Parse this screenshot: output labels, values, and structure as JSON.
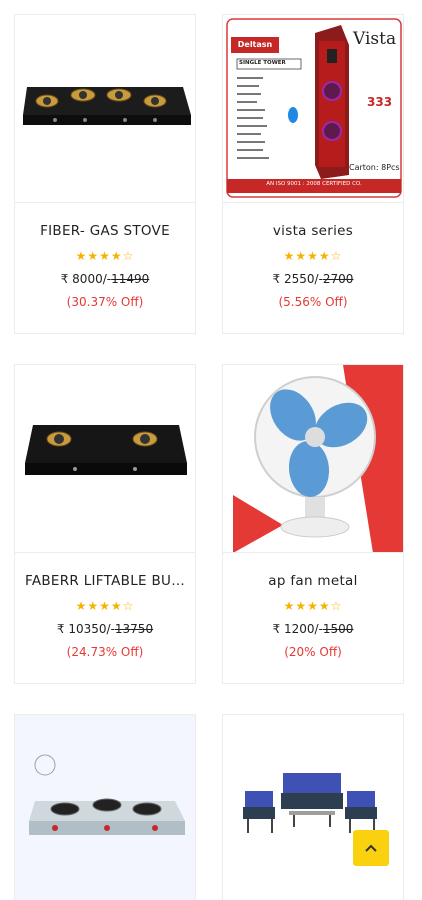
{
  "products": [
    {
      "name": "FIBER- GAS STOVE",
      "stars": "★★★★☆",
      "price": "₹ 8000/-",
      "old_price": "11490",
      "discount": "(30.37% Off)"
    },
    {
      "name": "vista series",
      "stars": "★★★★☆",
      "price": "₹ 2550/-",
      "old_price": "2700",
      "discount": "(5.56% Off)"
    },
    {
      "name": "FABERR LIFTABLE BUR...",
      "stars": "★★★★☆",
      "price": "₹ 10350/-",
      "old_price": "13750",
      "discount": "(24.73% Off)"
    },
    {
      "name": "ap fan metal",
      "stars": "★★★★☆",
      "price": "₹ 1200/-",
      "old_price": "1500",
      "discount": "(20% Off)"
    }
  ],
  "vista_box": {
    "brand": "Deltasn",
    "title": "Vista",
    "subtitle": "SINGLE TOWER",
    "model": "333",
    "carton": "Carton: 8Pcs",
    "footer": "AN ISO 9001 : 2008 CERTIFIED CO."
  },
  "scroll_top_icon": "chevron-up-icon",
  "colors": {
    "star": "#f5b301",
    "discount": "#e53935",
    "scroll_button": "#f9d10f"
  }
}
